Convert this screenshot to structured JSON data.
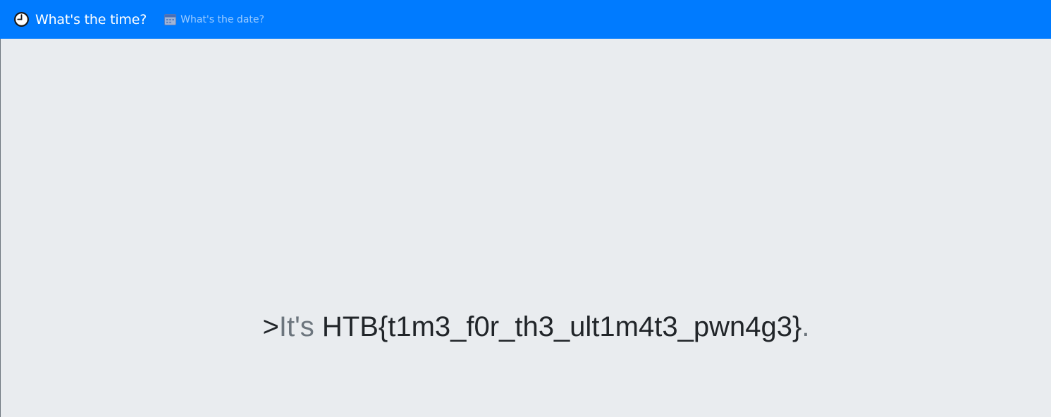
{
  "navbar": {
    "brand": {
      "icon": "clock-icon",
      "label": "What's the time?"
    },
    "links": [
      {
        "icon": "calendar-icon",
        "label": "What's the date?"
      }
    ],
    "background_color": "#007bff"
  },
  "main": {
    "message": {
      "prefix": ">",
      "lead": "It's ",
      "value": "HTB{t1m3_f0r_th3_ult1m4t3_pwn4g3}",
      "suffix": "."
    },
    "background_color": "#e9ecef",
    "muted_color": "#6c757d",
    "text_color": "#212529"
  }
}
